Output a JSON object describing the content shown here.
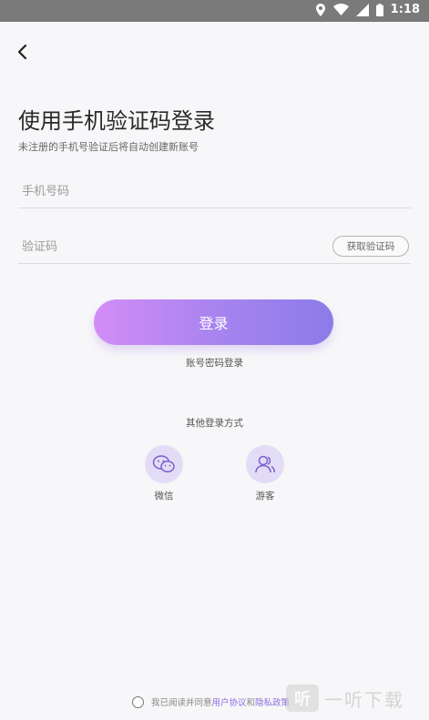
{
  "status_bar": {
    "time": "1:18"
  },
  "page": {
    "title": "使用手机验证码登录",
    "subtitle": "未注册的手机号验证后将自动创建新账号"
  },
  "phone": {
    "placeholder": "手机号码"
  },
  "code": {
    "placeholder": "验证码",
    "get_code_label": "获取验证码"
  },
  "login_button": {
    "label": "登录"
  },
  "account_login": {
    "label": "账号密码登录"
  },
  "other_login": {
    "title": "其他登录方式",
    "options": [
      {
        "label": "微信",
        "icon": "wechat-icon"
      },
      {
        "label": "游客",
        "icon": "guest-icon"
      }
    ]
  },
  "agreement": {
    "prefix": "我已阅读并同意",
    "user_agreement": "用户协议",
    "and": "和",
    "privacy_policy": "隐私政策"
  },
  "watermark": {
    "logo": "听",
    "text": "一听下载"
  },
  "colors": {
    "accent": "#a583ef",
    "link": "#8a6de0"
  }
}
